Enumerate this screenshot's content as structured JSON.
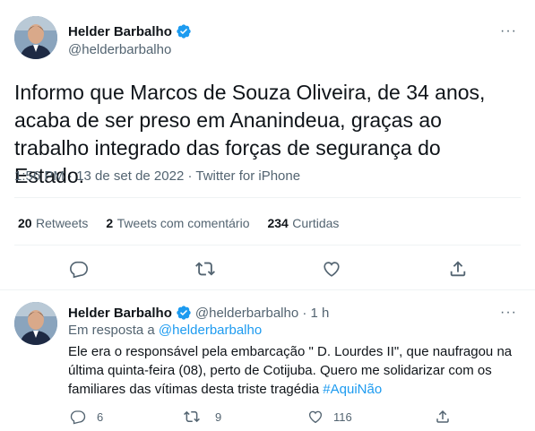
{
  "main_tweet": {
    "author_name": "Helder Barbalho",
    "handle": "@helderbarbalho",
    "text": "Informo que Marcos de Souza Oliveira, de 34 anos, acaba de ser preso em Ananindeua, graças ao trabalho integrado das forças de segurança do Estado.",
    "meta": "1:56 PM · 13 de set de 2022 · Twitter for iPhone",
    "stats": {
      "retweets_count": "20",
      "retweets_label": "Retweets",
      "quotes_count": "2",
      "quotes_label": "Tweets com comentário",
      "likes_count": "234",
      "likes_label": "Curtidas"
    },
    "more_label": "···"
  },
  "reply_tweet": {
    "author_name": "Helder Barbalho",
    "handle_time": "@helderbarbalho · 1 h",
    "reply_prefix": "Em resposta a",
    "reply_to": "@helderbarbalho",
    "text": "Ele era o responsável pela embarcação \" D. Lourdes II\", que naufragou na última quinta-feira (08), perto de Cotijuba. Quero me solidarizar com os familiares das vítimas desta triste tragédia",
    "hashtag": "#AquiNão",
    "more_label": "···",
    "actions": {
      "reply_count": "6",
      "retweet_count": "9",
      "like_count": "116"
    }
  },
  "colors": {
    "accent": "#1d9bf0",
    "muted": "#536471",
    "divider": "#eff3f4"
  },
  "icons": [
    "verified-badge-icon",
    "reply-icon",
    "retweet-icon",
    "like-icon",
    "share-icon",
    "more-icon"
  ]
}
